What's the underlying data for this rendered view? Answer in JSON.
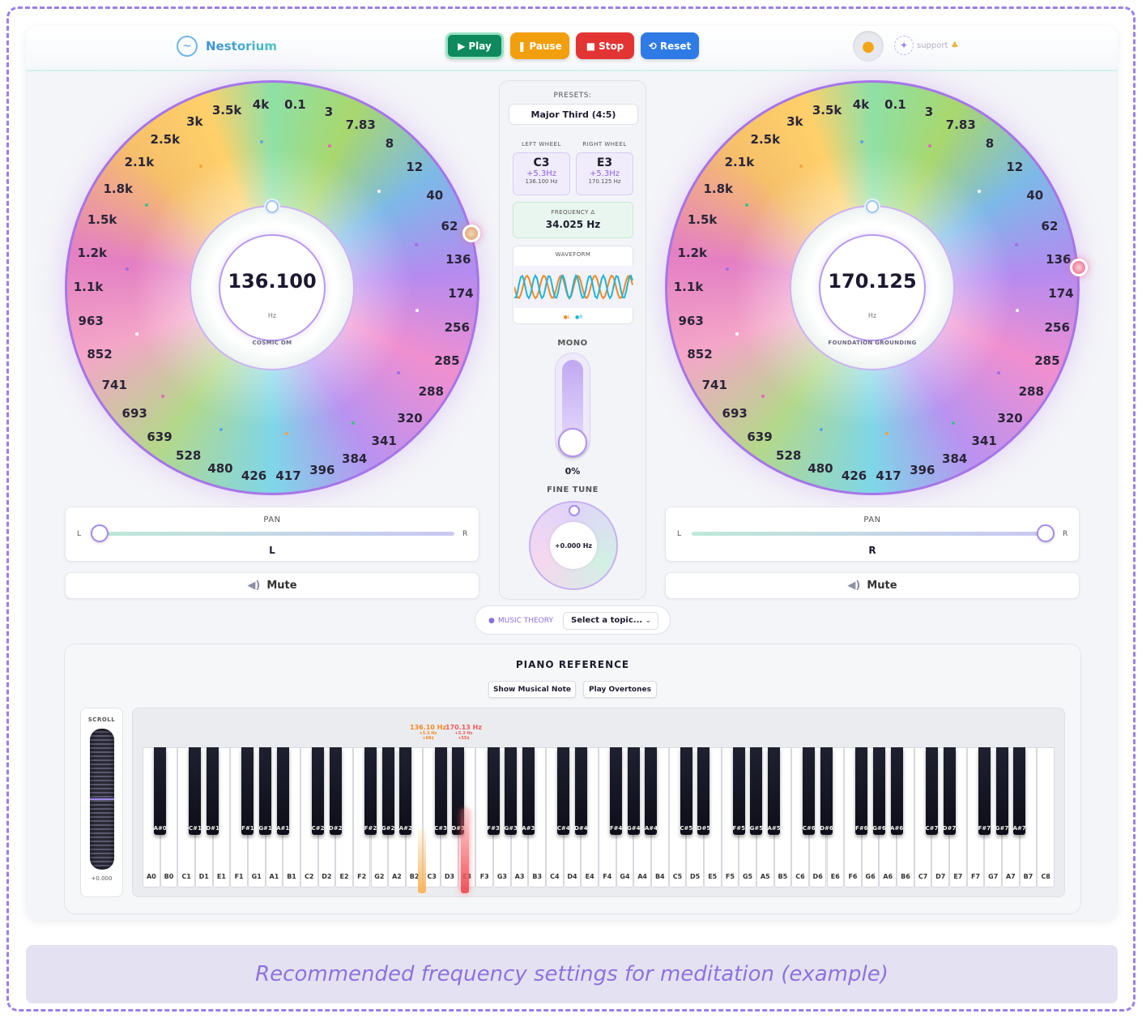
{
  "header": {
    "brand": "Nestorium",
    "buttons": {
      "play": "Play",
      "pause": "Pause",
      "stop": "Stop",
      "reset": "Reset"
    },
    "support": "support"
  },
  "wheel_labels": [
    "0.1",
    "3",
    "7.83",
    "8",
    "12",
    "40",
    "62",
    "136",
    "174",
    "256",
    "285",
    "288",
    "320",
    "341",
    "384",
    "396",
    "417",
    "426",
    "480",
    "528",
    "639",
    "693",
    "741",
    "852",
    "963",
    "1.1k",
    "1.2k",
    "1.5k",
    "1.8k",
    "2.1k",
    "2.5k",
    "3k",
    "3.5k",
    "4k"
  ],
  "left_wheel": {
    "frequency": "136.100",
    "unit": "Hz",
    "name": "COSMIC OM"
  },
  "right_wheel": {
    "frequency": "170.125",
    "unit": "Hz",
    "name": "FOUNDATION GROUNDING"
  },
  "center": {
    "presets_label": "PRESETS:",
    "preset": "Major Third (4:5)",
    "left_label": "LEFT WHEEL",
    "right_label": "RIGHT WHEEL",
    "left_note": {
      "name": "C3",
      "offset": "+5.3Hz",
      "hz": "136.100 Hz"
    },
    "right_note": {
      "name": "E3",
      "offset": "+5.3Hz",
      "hz": "170.125 Hz"
    },
    "delta_label": "FREQUENCY Δ",
    "delta_value": "34.025 Hz",
    "waveform_label": "WAVEFORM",
    "legend_l": "L",
    "legend_r": "R",
    "mono_label": "MONO",
    "mono_value": "0%",
    "mono_level": 0,
    "fine_tune_label": "FINE TUNE",
    "fine_tune_value": "+0.000 Hz"
  },
  "pan_left": {
    "title": "PAN",
    "l": "L",
    "r": "R",
    "value": "L",
    "position": 0
  },
  "pan_right": {
    "title": "PAN",
    "l": "L",
    "r": "R",
    "value": "R",
    "position": 1
  },
  "mute_label": "Mute",
  "music_theory": {
    "label": "MUSIC THEORY",
    "select": "Select a topic..."
  },
  "piano": {
    "title": "PIANO REFERENCE",
    "show_note_btn": "Show Musical Note",
    "overtones_btn": "Play Overtones",
    "scroll_label": "SCROLL",
    "scroll_value": "+0.000",
    "white_keys": [
      "A0",
      "B0",
      "C1",
      "D1",
      "E1",
      "F1",
      "G1",
      "A1",
      "B1",
      "C2",
      "D2",
      "E2",
      "F2",
      "G2",
      "A2",
      "B2",
      "C3",
      "D3",
      "E3",
      "F3",
      "G3",
      "A3",
      "B3",
      "C4",
      "D4",
      "E4",
      "F4",
      "G4",
      "A4",
      "B4",
      "C5",
      "D5",
      "E5",
      "F5",
      "G5",
      "A5",
      "B5",
      "C6",
      "D6",
      "E6",
      "F6",
      "G6",
      "A6",
      "B6",
      "C7",
      "D7",
      "E7",
      "F7",
      "G7",
      "A7",
      "B7",
      "C8"
    ],
    "black_keys": [
      "A#0",
      "C#1",
      "D#1",
      "F#1",
      "G#1",
      "A#1",
      "C#2",
      "D#2",
      "F#2",
      "G#2",
      "A#2",
      "C#3",
      "D#3",
      "F#3",
      "G#3",
      "A#3",
      "C#4",
      "D#4",
      "F#4",
      "G#4",
      "A#4",
      "C#5",
      "D#5",
      "F#5",
      "G#5",
      "A#5",
      "C#6",
      "D#6",
      "F#6",
      "G#6",
      "A#6",
      "C#7",
      "D#7",
      "F#7",
      "G#7",
      "A#7"
    ],
    "left_marker": {
      "freq": "136.10 Hz",
      "offset": "+5.3 Hz",
      "cents": "+68¢"
    },
    "right_marker": {
      "freq": "170.13 Hz",
      "offset": "+5.3 Hz",
      "cents": "+55¢"
    }
  },
  "caption": "Recommended frequency settings for meditation (example)"
}
